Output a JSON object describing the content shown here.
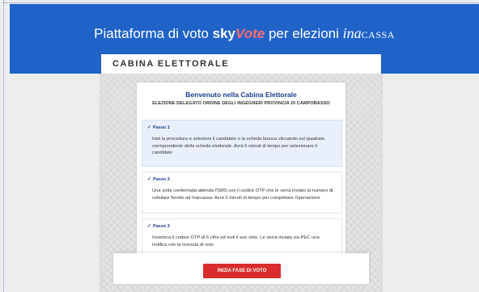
{
  "header": {
    "title_prefix": "Piattaforma di voto",
    "brand_sky": "sky",
    "brand_vote": "Vote",
    "title_suffix": "per elezioni",
    "logo_ina": "ina",
    "logo_cassa": "CASSA",
    "background_color": "#1f63c9"
  },
  "cabina": {
    "title": "CABINA ELETTORALE",
    "welcome": "Benvenuto nella Cabina Elettorale",
    "election": "ELEZIONE DELEGATO ORDINE DEGLI INGEGNERI PROVINCIA DI CAMPOBASSO",
    "steps": [
      {
        "label": "Passo 1",
        "icon": "check-icon",
        "text": "Inizi la procedura e selezioni il candidato o la scheda bianca cliccando sul quadrato corrispondente della scheda elettorale. Avrà 5 minuti di tempo per selezionare il candidato"
      },
      {
        "label": "Passo 2",
        "icon": "check-icon",
        "text": "Una volta confermata attenda l'SMS con il codice OTP che le verrà inviato al numero di cellulare fornito ad Inarcassa. Avrà 2 minuti di tempo per completare l'operazione"
      },
      {
        "label": "Passo 3",
        "icon": "check-icon",
        "text": "Inserisca il codice OTP di 6 cifre ed invii il suo voto. Le verrà inviata via PEC una notifica con la ricevuta di voto"
      }
    ],
    "start_button": "INIZIA FASE DI VOTO",
    "accent_color": "#d92c2c"
  }
}
